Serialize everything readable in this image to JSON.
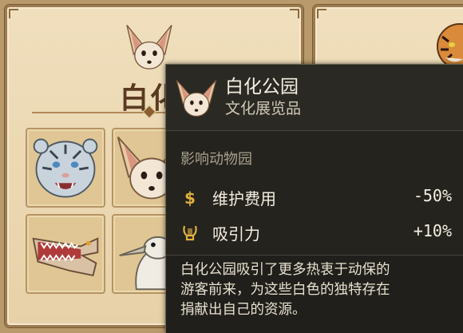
{
  "left_panel": {
    "title": "白化"
  },
  "tiles": [
    {
      "name": "white-tiger-icon"
    },
    {
      "name": "fennec-fox-icon"
    },
    {
      "name": "albino-crocodile-icon"
    },
    {
      "name": "white-bird-icon"
    }
  ],
  "right_panel": {
    "partial_icon": "tiger-icon"
  },
  "tooltip": {
    "icon": "fennec-fox-icon",
    "title": "白化公园",
    "subtitle": "文化展览品",
    "section_heading": "影响动物园",
    "effects": [
      {
        "icon": "dollar-icon",
        "label": "维护费用",
        "value": "-50%",
        "color": "#e0b040"
      },
      {
        "icon": "lyre-icon",
        "label": "吸引力",
        "value": "+10%",
        "color": "#e0b040"
      }
    ],
    "description_lines": [
      "白化公园吸引了更多热衷于动保的",
      "游客前来，为这些白色的独特存在",
      "捐献出自己的资源。"
    ]
  }
}
